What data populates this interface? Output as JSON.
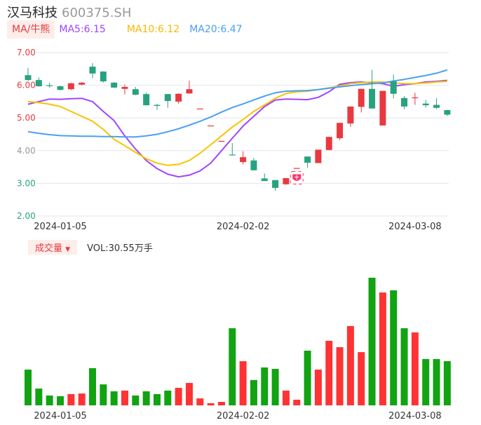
{
  "header": {
    "name": "汉马科技",
    "code": "600375.SH"
  },
  "ma_bar": {
    "button": "MA/牛熊",
    "ma5": "MA5:6.15",
    "ma10": "MA10:6.12",
    "ma20": "MA20:6.47"
  },
  "volume_bar": {
    "button": "成交量",
    "dropdown_icon": "triangle-down",
    "value": "VOL:30.55万手"
  },
  "colors": {
    "up": "#e8393f",
    "down": "#27a27f",
    "ma5": "#a044ff",
    "ma10": "#f8c400",
    "ma20": "#4aa0f5",
    "vol_up": "#ff3333",
    "vol_down": "#12a312"
  },
  "chart_data": [
    {
      "type": "candlestick",
      "title": "汉马科技 600375.SH",
      "ylim": [
        2,
        7
      ],
      "y_ticks": [
        {
          "label": "7.00",
          "value": 7,
          "color": "#e8393f"
        },
        {
          "label": "6.00",
          "value": 6,
          "color": "#e8393f"
        },
        {
          "label": "5.00",
          "value": 5,
          "color": "#e8393f"
        },
        {
          "label": "4.00",
          "value": 4,
          "color": "#999999"
        },
        {
          "label": "3.00",
          "value": 3,
          "color": "#27a27f"
        },
        {
          "label": "2.00",
          "value": 2,
          "color": "#27a27f"
        }
      ],
      "x_ticks": [
        {
          "label": "2024-01-05",
          "index": 3
        },
        {
          "label": "2024-02-02",
          "index": 20
        },
        {
          "label": "2024-03-08",
          "index": 36
        }
      ],
      "ohlc": [
        [
          6.31,
          6.53,
          6.14,
          6.16
        ],
        [
          6.16,
          6.24,
          5.96,
          5.97
        ],
        [
          6.0,
          6.08,
          5.93,
          5.98
        ],
        [
          5.97,
          5.99,
          5.84,
          5.86
        ],
        [
          5.88,
          6.08,
          5.85,
          6.06
        ],
        [
          6.02,
          6.1,
          6.0,
          6.08
        ],
        [
          6.57,
          6.68,
          6.22,
          6.36
        ],
        [
          6.42,
          6.43,
          6.08,
          6.12
        ],
        [
          6.08,
          6.1,
          5.92,
          5.93
        ],
        [
          5.89,
          6.02,
          5.72,
          5.95
        ],
        [
          5.88,
          5.95,
          5.7,
          5.71
        ],
        [
          5.73,
          5.78,
          5.38,
          5.39
        ],
        [
          5.4,
          5.43,
          5.25,
          5.37
        ],
        [
          5.73,
          5.74,
          5.31,
          5.52
        ],
        [
          5.5,
          5.76,
          5.44,
          5.74
        ],
        [
          5.75,
          6.14,
          5.74,
          5.88
        ],
        [
          5.29,
          5.29,
          5.29,
          5.29
        ],
        [
          4.77,
          4.77,
          4.77,
          4.77
        ],
        [
          4.3,
          4.3,
          4.3,
          4.3
        ],
        [
          3.88,
          4.23,
          3.85,
          3.86
        ],
        [
          3.65,
          3.98,
          3.58,
          3.8
        ],
        [
          3.7,
          3.78,
          3.4,
          3.4
        ],
        [
          3.15,
          3.3,
          3.07,
          3.07
        ],
        [
          3.1,
          3.1,
          2.77,
          2.86
        ],
        [
          2.97,
          3.16,
          2.96,
          3.16
        ],
        [
          3.47,
          3.47,
          3.47,
          3.47
        ],
        [
          3.82,
          3.82,
          3.48,
          3.63
        ],
        [
          3.62,
          4.03,
          3.62,
          4.03
        ],
        [
          4.02,
          4.42,
          4.01,
          4.42
        ],
        [
          4.38,
          4.85,
          4.32,
          4.85
        ],
        [
          4.83,
          5.35,
          4.73,
          5.35
        ],
        [
          5.34,
          5.89,
          5.17,
          5.89
        ],
        [
          5.89,
          6.47,
          5.29,
          5.29
        ],
        [
          4.77,
          5.83,
          4.77,
          5.83
        ],
        [
          6.12,
          6.33,
          5.6,
          5.74
        ],
        [
          5.61,
          5.67,
          5.27,
          5.35
        ],
        [
          5.63,
          5.77,
          5.4,
          5.63
        ],
        [
          5.44,
          5.55,
          5.32,
          5.39
        ],
        [
          5.4,
          5.61,
          5.27,
          5.31
        ],
        [
          5.24,
          5.25,
          5.06,
          5.1
        ]
      ],
      "series": [
        {
          "name": "MA5",
          "values": [
            5.42,
            5.5,
            5.58,
            5.57,
            5.59,
            5.6,
            5.5,
            5.2,
            4.92,
            4.45,
            4.05,
            3.7,
            3.45,
            3.28,
            3.2,
            3.25,
            3.38,
            3.62,
            4.0,
            4.38,
            4.75,
            5.05,
            5.35,
            5.55,
            5.58,
            5.57,
            5.56,
            5.63,
            5.8,
            6.03,
            6.08,
            6.1,
            6.08,
            6.05,
            5.97,
            6.02,
            6.05,
            6.1,
            6.12,
            6.15
          ]
        },
        {
          "name": "MA10",
          "values": [
            5.5,
            5.47,
            5.42,
            5.35,
            5.2,
            5.05,
            4.9,
            4.65,
            4.35,
            4.15,
            3.95,
            3.75,
            3.62,
            3.55,
            3.58,
            3.7,
            3.92,
            4.18,
            4.45,
            4.72,
            4.95,
            5.2,
            5.4,
            5.6,
            5.75,
            5.8,
            5.82,
            5.87,
            5.92,
            5.98,
            6.05,
            6.08,
            6.1,
            6.1,
            6.07,
            6.05,
            6.05,
            6.07,
            6.1,
            6.12
          ]
        },
        {
          "name": "MA20",
          "values": [
            4.58,
            4.53,
            4.49,
            4.46,
            4.45,
            4.44,
            4.44,
            4.43,
            4.43,
            4.42,
            4.42,
            4.45,
            4.5,
            4.58,
            4.67,
            4.78,
            4.9,
            5.03,
            5.18,
            5.32,
            5.43,
            5.55,
            5.67,
            5.77,
            5.82,
            5.83,
            5.84,
            5.87,
            5.91,
            5.95,
            5.99,
            6.02,
            6.05,
            6.07,
            6.13,
            6.18,
            6.24,
            6.3,
            6.37,
            6.47
          ]
        }
      ],
      "marker": {
        "index": 25,
        "label": "牛"
      }
    },
    {
      "type": "bar",
      "title": "成交量",
      "unit": "万手",
      "x_ticks": [
        {
          "label": "2024-01-05",
          "index": 3
        },
        {
          "label": "2024-02-02",
          "index": 20
        },
        {
          "label": "2024-03-08",
          "index": 36
        }
      ],
      "values": [
        24.7,
        11.6,
        6.8,
        6.3,
        7.8,
        8.2,
        25.7,
        14.5,
        9.7,
        10.2,
        6.8,
        9.7,
        7.8,
        10.2,
        12.1,
        15.5,
        4.8,
        1.5,
        2.4,
        53.3,
        30.5,
        17.5,
        26.2,
        25.2,
        10.2,
        3.9,
        37.8,
        24.7,
        44.6,
        40.2,
        54.8,
        36.8,
        88.2,
        78.0,
        79.5,
        53.3,
        50.4,
        32.0,
        32.0,
        30.55
      ]
    }
  ]
}
